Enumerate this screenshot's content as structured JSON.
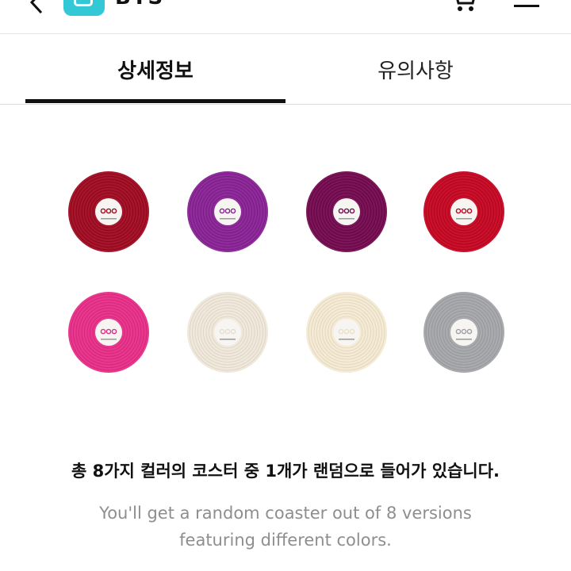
{
  "header": {
    "brand": "BTS",
    "icons": [
      "back-arrow-icon",
      "app-icon",
      "cart-icon",
      "menu-icon"
    ]
  },
  "tabs": [
    {
      "label": "상세정보",
      "active": true
    },
    {
      "label": "유의사항",
      "active": false
    }
  ],
  "coasters": [
    {
      "color": "#a3162c"
    },
    {
      "color": "#8e2d9a"
    },
    {
      "color": "#7a1557"
    },
    {
      "color": "#c8112c"
    },
    {
      "color": "#e8388d"
    },
    {
      "color": "#f0e8db"
    },
    {
      "color": "#f5ead3"
    },
    {
      "color": "#a9aaad"
    }
  ],
  "content": {
    "caption_ko": "총 8가지 컬러의 코스터 중 1개가 랜덤으로 들어가 있습니다.",
    "caption_en_line1": "You'll get a random coaster out of 8 versions",
    "caption_en_line2": "featuring different colors."
  }
}
